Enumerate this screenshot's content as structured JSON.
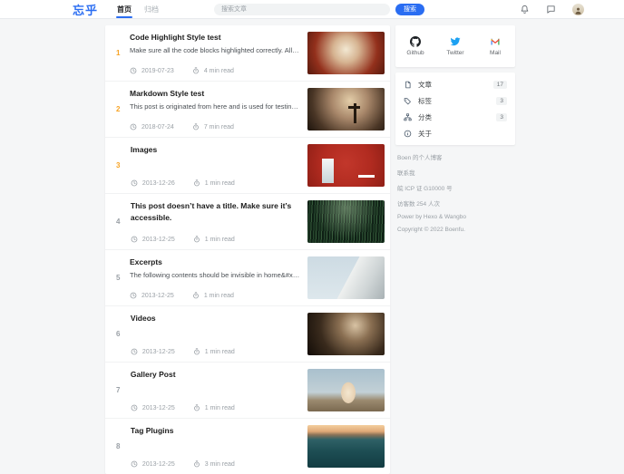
{
  "header": {
    "logo": "忘乎",
    "nav": [
      {
        "label": "首页",
        "active": true
      },
      {
        "label": "归档",
        "active": false
      }
    ],
    "search_placeholder": "搜索文章",
    "search_button": "搜索"
  },
  "posts": [
    {
      "rank": "1",
      "title": "Code Highlight Style test",
      "excerpt": "Make sure all the code blocks highlighted correctly. All the co…",
      "date": "2019-07-23",
      "read_time": "4 min read",
      "thumb": "autumn-forest-photo"
    },
    {
      "rank": "2",
      "title": "Markdown Style test",
      "excerpt": "This post is originated from here and is used for testing markd…",
      "date": "2018-07-24",
      "read_time": "7 min read",
      "thumb": "cross-sky-photo"
    },
    {
      "rank": "3",
      "title": "Images",
      "excerpt": "",
      "date": "2013-12-26",
      "read_time": "1 min read",
      "thumb": "red-door-photo"
    },
    {
      "rank": "4",
      "title": "This post doesn’t have a title. Make sure it’s accessible.",
      "excerpt": "",
      "date": "2013-12-25",
      "read_time": "1 min read",
      "thumb": "bamboo-forest-photo"
    },
    {
      "rank": "5",
      "title": "Excerpts",
      "excerpt": "The following contents should be invisible in home&#x2F;arc…",
      "date": "2013-12-25",
      "read_time": "1 min read",
      "thumb": "building-photo"
    },
    {
      "rank": "6",
      "title": "Videos",
      "excerpt": "",
      "date": "2013-12-25",
      "read_time": "1 min read",
      "thumb": "dark-rocks-photo"
    },
    {
      "rank": "7",
      "title": "Gallery Post",
      "excerpt": "",
      "date": "2013-12-25",
      "read_time": "1 min read",
      "thumb": "cat-photo"
    },
    {
      "rank": "8",
      "title": "Tag Plugins",
      "excerpt": "",
      "date": "2013-12-25",
      "read_time": "3 min read",
      "thumb": "ocean-wave-photo"
    }
  ],
  "sidebar": {
    "social": [
      {
        "label": "Github",
        "icon": "github-icon"
      },
      {
        "label": "Twitter",
        "icon": "twitter-icon"
      },
      {
        "label": "Mail",
        "icon": "mail-icon"
      }
    ],
    "stats": [
      {
        "label": "文章",
        "count": "17",
        "icon": "posts-icon"
      },
      {
        "label": "标签",
        "count": "3",
        "icon": "tags-icon"
      },
      {
        "label": "分类",
        "count": "3",
        "icon": "categories-icon"
      },
      {
        "label": "关于",
        "count": "",
        "icon": "about-icon"
      }
    ],
    "footer": [
      "Boen 的个人博客",
      "联系我",
      "皖 ICP 证 G10000 号",
      "访客数 254 人次",
      "Power by Hexo & Wangbo",
      "Copyright © 2022 Boenfu."
    ]
  },
  "colors": {
    "accent": "#2a6df2",
    "rank_top": "#f7a325",
    "rank_normal": "#9aa0a6"
  }
}
